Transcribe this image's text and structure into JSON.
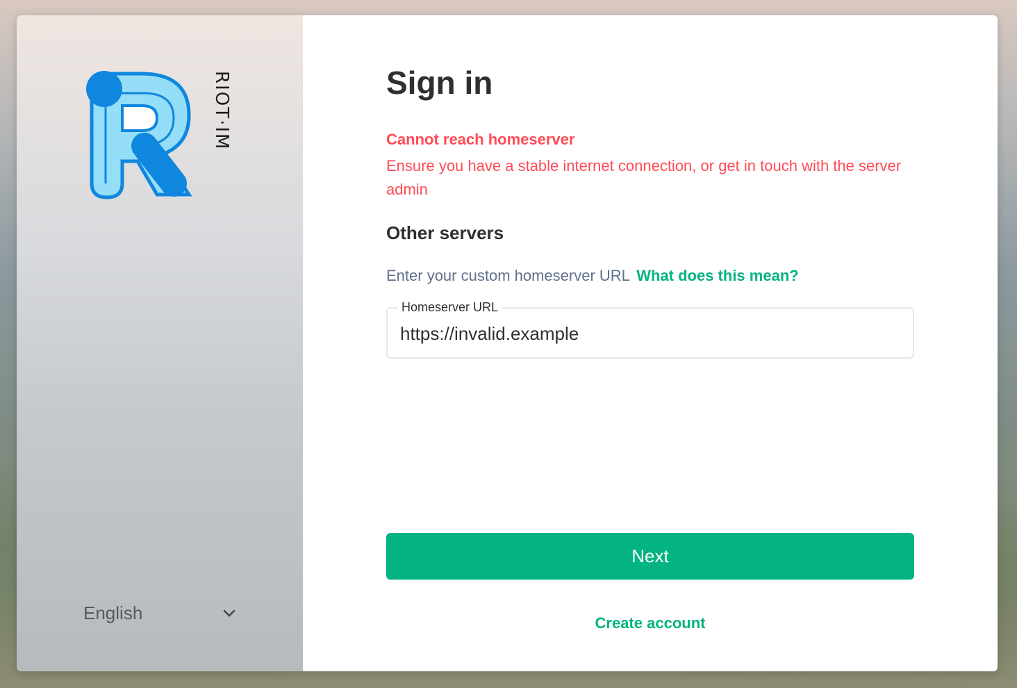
{
  "branding": {
    "wordmark": "RIOT·IM"
  },
  "language": {
    "selected": "English",
    "icon": "chevron-down-icon"
  },
  "auth": {
    "title": "Sign in",
    "error_title": "Cannot reach homeserver",
    "error_body": "Ensure you have a stable internet connection, or get in touch with the server admin",
    "section_title": "Other servers",
    "hint_text": "Enter your custom homeserver URL",
    "hint_link": "What does this mean?",
    "url_label": "Homeserver URL",
    "url_value": "https://invalid.example",
    "next_label": "Next",
    "create_account": "Create account"
  },
  "colors": {
    "accent": "#03b381",
    "error": "#ff4b55",
    "logo_light": "#8fdcf5",
    "logo_dark": "#0f87de"
  }
}
